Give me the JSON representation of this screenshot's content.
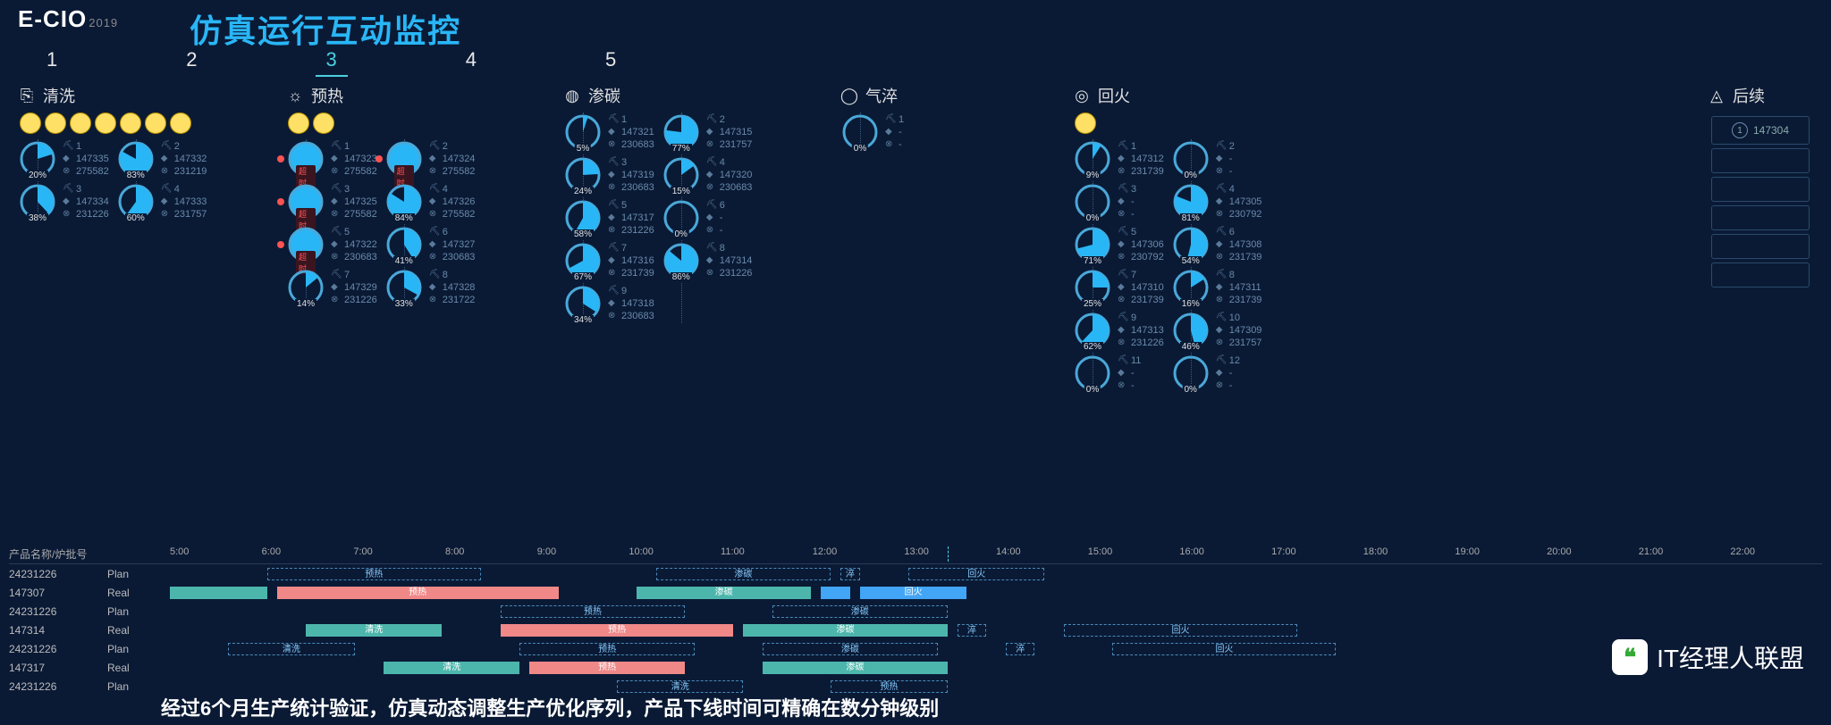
{
  "logo": {
    "main": "E-CIO",
    "year": "2019"
  },
  "title": "仿真运行互动监控",
  "tabs": [
    "1",
    "2",
    "3",
    "4",
    "5"
  ],
  "activeTab": 2,
  "stations": [
    {
      "name": "清洗",
      "icon": "⎘",
      "dots": 7,
      "cols": [
        [
          {
            "n": "1",
            "a": "147335",
            "b": "275582",
            "p": 20
          },
          {
            "n": "3",
            "a": "147334",
            "b": "231226",
            "p": 38
          }
        ],
        [
          {
            "n": "2",
            "a": "147332",
            "b": "231219",
            "p": 83
          },
          {
            "n": "4",
            "a": "147333",
            "b": "231757",
            "p": 60
          }
        ]
      ]
    },
    {
      "name": "预热",
      "icon": "☼",
      "dots": 2,
      "cols": [
        [
          {
            "n": "1",
            "a": "147323",
            "b": "275582",
            "p": 100,
            "ot": true,
            "rd": true
          },
          {
            "n": "3",
            "a": "147325",
            "b": "275582",
            "p": 100,
            "ot": true,
            "rd": true
          },
          {
            "n": "5",
            "a": "147322",
            "b": "230683",
            "p": 100,
            "ot": true,
            "rd": true
          },
          {
            "n": "7",
            "a": "147329",
            "b": "231226",
            "p": 14
          }
        ],
        [
          {
            "n": "2",
            "a": "147324",
            "b": "275582",
            "p": 100,
            "ot": true,
            "rd": true
          },
          {
            "n": "4",
            "a": "147326",
            "b": "275582",
            "p": 84
          },
          {
            "n": "6",
            "a": "147327",
            "b": "230683",
            "p": 41
          },
          {
            "n": "8",
            "a": "147328",
            "b": "231722",
            "p": 33
          }
        ]
      ]
    },
    {
      "name": "渗碳",
      "icon": "◍",
      "cols": [
        [
          {
            "n": "1",
            "a": "147321",
            "b": "230683",
            "p": 5
          },
          {
            "n": "3",
            "a": "147319",
            "b": "230683",
            "p": 24
          },
          {
            "n": "5",
            "a": "147317",
            "b": "231226",
            "p": 58
          },
          {
            "n": "7",
            "a": "147316",
            "b": "231739",
            "p": 67
          },
          {
            "n": "9",
            "a": "147318",
            "b": "230683",
            "p": 34
          }
        ],
        [
          {
            "n": "2",
            "a": "147315",
            "b": "231757",
            "p": 77
          },
          {
            "n": "4",
            "a": "147320",
            "b": "230683",
            "p": 15
          },
          {
            "n": "6",
            "a": "-",
            "b": "-",
            "p": 0
          },
          {
            "n": "8",
            "a": "147314",
            "b": "231226",
            "p": 86
          }
        ]
      ]
    },
    {
      "name": "气淬",
      "icon": "◯",
      "cols": [
        [
          {
            "n": "1",
            "a": "-",
            "b": "-",
            "p": 0
          }
        ]
      ]
    },
    {
      "name": "回火",
      "icon": "◎",
      "dots": 1,
      "cols": [
        [
          {
            "n": "1",
            "a": "147312",
            "b": "231739",
            "p": 9
          },
          {
            "n": "3",
            "a": "-",
            "b": "-",
            "p": 0
          },
          {
            "n": "5",
            "a": "147306",
            "b": "230792",
            "p": 71
          },
          {
            "n": "7",
            "a": "147310",
            "b": "231739",
            "p": 25
          },
          {
            "n": "9",
            "a": "147313",
            "b": "231226",
            "p": 62
          },
          {
            "n": "11",
            "a": "-",
            "b": "-",
            "p": 0
          }
        ],
        [
          {
            "n": "2",
            "a": "-",
            "b": "-",
            "p": 0
          },
          {
            "n": "4",
            "a": "147305",
            "b": "230792",
            "p": 81
          },
          {
            "n": "6",
            "a": "147308",
            "b": "231739",
            "p": 54
          },
          {
            "n": "8",
            "a": "147311",
            "b": "231739",
            "p": 16
          },
          {
            "n": "10",
            "a": "147309",
            "b": "231757",
            "p": 46
          },
          {
            "n": "12",
            "a": "-",
            "b": "-",
            "p": 0
          }
        ]
      ]
    }
  ],
  "queueTitle": "后续",
  "queueIcon": "◬",
  "queue": [
    {
      "n": "1",
      "v": "147304"
    },
    {
      "v": ""
    },
    {
      "v": ""
    },
    {
      "v": ""
    },
    {
      "v": ""
    },
    {
      "v": ""
    }
  ],
  "gantt": {
    "leftHeader": "产品名称/炉批号",
    "times": [
      "5:00",
      "6:00",
      "7:00",
      "8:00",
      "9:00",
      "10:00",
      "11:00",
      "12:00",
      "13:00",
      "14:00",
      "15:00",
      "16:00",
      "17:00",
      "18:00",
      "19:00",
      "20:00",
      "21:00",
      "22:00"
    ],
    "nowAt": 8,
    "rows": [
      {
        "name": "24231226",
        "type": "Plan",
        "bars": [
          {
            "l": "预热",
            "s": 1,
            "e": 3.2,
            "c": "plan"
          },
          {
            "l": "渗碳",
            "s": 5,
            "e": 6.8,
            "c": "plan"
          },
          {
            "l": "淬",
            "s": 6.9,
            "e": 7.1,
            "c": "plan"
          },
          {
            "l": "回火",
            "s": 7.6,
            "e": 9,
            "c": "plan"
          }
        ]
      },
      {
        "name": "147307",
        "type": "Real",
        "bars": [
          {
            "l": "",
            "s": 0,
            "e": 1,
            "c": "teal"
          },
          {
            "l": "预热",
            "s": 1.1,
            "e": 4,
            "c": "pink"
          },
          {
            "l": "渗碳",
            "s": 4.8,
            "e": 6.6,
            "c": "teal"
          },
          {
            "l": "",
            "s": 6.7,
            "e": 7,
            "c": "blue"
          },
          {
            "l": "回火",
            "s": 7.1,
            "e": 8.2,
            "c": "blue"
          }
        ]
      },
      {
        "name": "24231226",
        "type": "Plan",
        "bars": [
          {
            "l": "预热",
            "s": 3.4,
            "e": 5.3,
            "c": "plan"
          },
          {
            "l": "渗碳",
            "s": 6.2,
            "e": 8,
            "c": "plan"
          }
        ]
      },
      {
        "name": "147314",
        "type": "Real",
        "bars": [
          {
            "l": "清洗",
            "s": 1.4,
            "e": 2.8,
            "c": "teal"
          },
          {
            "l": "预热",
            "s": 3.4,
            "e": 5.8,
            "c": "pink"
          },
          {
            "l": "渗碳",
            "s": 5.9,
            "e": 8,
            "c": "teal"
          },
          {
            "l": "淬",
            "s": 8.1,
            "e": 8.4,
            "c": "plan"
          },
          {
            "l": "回火",
            "s": 9.2,
            "e": 11.6,
            "c": "plan"
          }
        ]
      },
      {
        "name": "24231226",
        "type": "Plan",
        "bars": [
          {
            "l": "清洗",
            "s": 0.6,
            "e": 1.9,
            "c": "plan"
          },
          {
            "l": "预热",
            "s": 3.6,
            "e": 5.4,
            "c": "plan"
          },
          {
            "l": "渗碳",
            "s": 6.1,
            "e": 7.9,
            "c": "plan"
          },
          {
            "l": "淬",
            "s": 8.6,
            "e": 8.9,
            "c": "plan"
          },
          {
            "l": "回火",
            "s": 9.7,
            "e": 12,
            "c": "plan"
          }
        ]
      },
      {
        "name": "147317",
        "type": "Real",
        "bars": [
          {
            "l": "清洗",
            "s": 2.2,
            "e": 3.6,
            "c": "teal"
          },
          {
            "l": "预热",
            "s": 3.7,
            "e": 5.3,
            "c": "pink"
          },
          {
            "l": "渗碳",
            "s": 6.1,
            "e": 8,
            "c": "teal"
          }
        ]
      },
      {
        "name": "24231226",
        "type": "Plan",
        "bars": [
          {
            "l": "清洗",
            "s": 4.6,
            "e": 5.9,
            "c": "plan"
          },
          {
            "l": "预热",
            "s": 6.8,
            "e": 8,
            "c": "plan"
          }
        ]
      }
    ]
  },
  "footer": "经过6个月生产统计验证，仿真动态调整生产优化序列，产品下线时间可精确在数分钟级别",
  "watermark": "IT经理人联盟",
  "overtimeLabel": "超时"
}
